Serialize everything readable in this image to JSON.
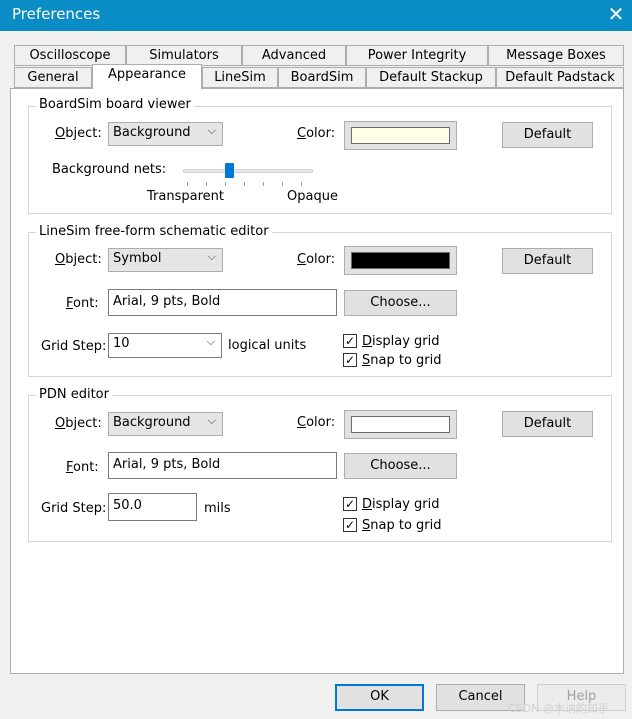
{
  "window": {
    "title": "Preferences"
  },
  "tabs_row1": [
    "Oscilloscope",
    "Simulators",
    "Advanced",
    "Power Integrity",
    "Message Boxes"
  ],
  "tabs_row2": [
    "General",
    "Appearance",
    "LineSim",
    "BoardSim",
    "Default Stackup",
    "Default Padstack"
  ],
  "boardsim": {
    "title": "BoardSim board viewer",
    "object_label_u": "O",
    "object_label_rest": "bject:",
    "object_value": "Background",
    "color_label_u": "C",
    "color_label_rest": "olor:",
    "color_swatch": "#ffffe8",
    "default_label": "Default",
    "bg_nets_label": "Background nets:",
    "slider_value_fraction": 0.35,
    "transparent_label": "Transparent",
    "opaque_label": "Opaque"
  },
  "linesim": {
    "title": "LineSim free-form schematic editor",
    "object_label_u": "O",
    "object_label_rest": "bject:",
    "object_value": "Symbol",
    "color_label_u": "C",
    "color_label_rest": "olor:",
    "color_swatch": "#000000",
    "default_label": "Default",
    "font_label_u": "F",
    "font_label_rest": "ont:",
    "font_value": "Arial, 9 pts, Bold",
    "choose_label": "Choose...",
    "grid_label": "Grid Step:",
    "grid_value": "10",
    "grid_unit": "logical units",
    "display_grid_u": "D",
    "display_grid_rest": "isplay grid",
    "display_grid_checked": true,
    "snap_grid_u": "S",
    "snap_grid_rest": "nap to grid",
    "snap_grid_checked": true
  },
  "pdn": {
    "title": "PDN editor",
    "object_label_u": "O",
    "object_label_rest": "bject:",
    "object_value": "Background",
    "color_label_u": "C",
    "color_label_rest": "olor:",
    "color_swatch": "#ffffff",
    "default_label": "Default",
    "font_label_u": "F",
    "font_label_rest": "ont:",
    "font_value": "Arial, 9 pts, Bold",
    "choose_label": "Choose...",
    "grid_label": "Grid Step:",
    "grid_value": "50.0",
    "grid_unit": "mils",
    "display_grid_u": "D",
    "display_grid_rest": "isplay grid",
    "display_grid_checked": true,
    "snap_grid_u": "S",
    "snap_grid_rest": "nap to grid",
    "snap_grid_checked": true
  },
  "footer": {
    "ok": "OK",
    "cancel": "Cancel",
    "help": "Help"
  },
  "watermark": "CSDN @木讷的知乎"
}
